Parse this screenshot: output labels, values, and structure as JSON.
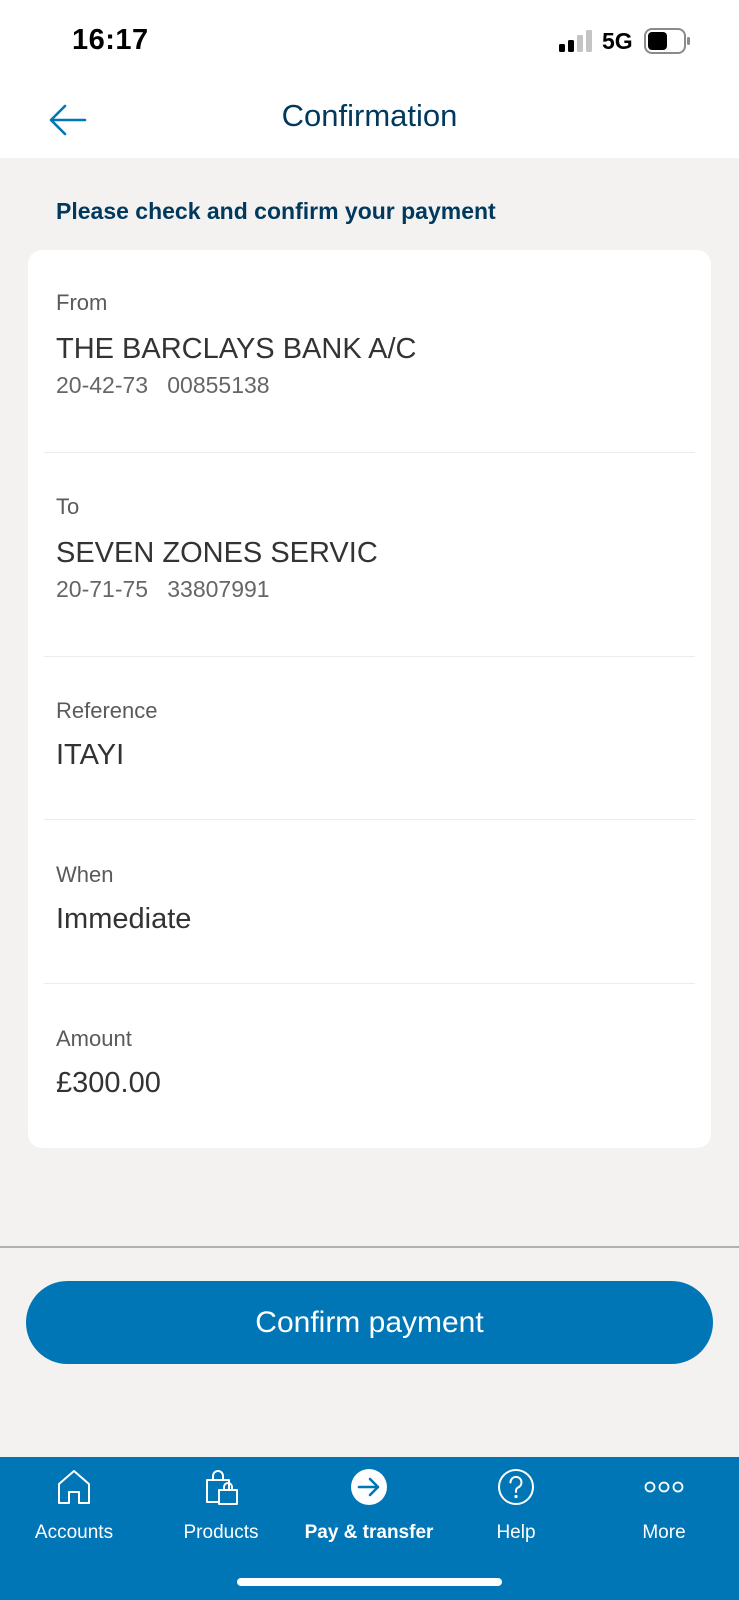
{
  "status_bar": {
    "time": "16:17",
    "network": "5G"
  },
  "header": {
    "back_icon": "arrow-left-icon",
    "title": "Confirmation"
  },
  "instruction": "Please check and confirm your payment",
  "details": {
    "from": {
      "label": "From",
      "name": "THE BARCLAYS BANK A/C",
      "sort_code": "20-42-73",
      "account_number": "00855138"
    },
    "to": {
      "label": "To",
      "name": "SEVEN ZONES SERVIC",
      "sort_code": "20-71-75",
      "account_number": "33807991"
    },
    "reference": {
      "label": "Reference",
      "value": "ITAYI"
    },
    "when": {
      "label": "When",
      "value": "Immediate"
    },
    "amount": {
      "label": "Amount",
      "value": "£300.00"
    }
  },
  "confirm_button": "Confirm payment",
  "tabs": [
    {
      "label": "Accounts",
      "icon": "home-icon"
    },
    {
      "label": "Products",
      "icon": "shopping-bag-icon"
    },
    {
      "label": "Pay & transfer",
      "icon": "arrow-right-circle-icon"
    },
    {
      "label": "Help",
      "icon": "question-circle-icon"
    },
    {
      "label": "More",
      "icon": "more-dots-icon"
    }
  ],
  "colors": {
    "brand_blue": "#0076b6",
    "title_navy": "#00395d",
    "background": "#f3f2f1"
  }
}
